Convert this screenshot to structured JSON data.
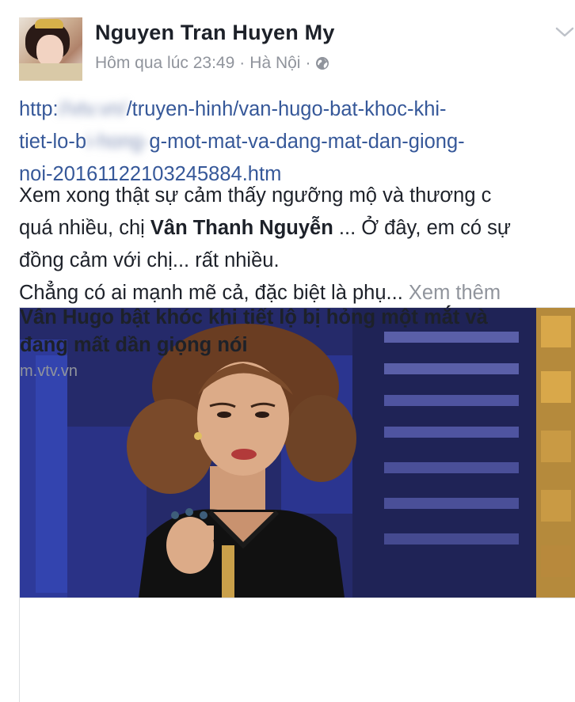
{
  "post": {
    "author": "Nguyen Tran Huyen My",
    "timestamp": "Hôm qua lúc 23:49",
    "separator": "·",
    "location": "Hà Nội",
    "privacy_icon": "globe-icon",
    "menu_icon": "chevron-down-icon",
    "link_lines": {
      "line1_start": "http:",
      "line1_blurred": "//vtv.vn/",
      "line1_end": "/truyen-hinh/van-hugo-bat-khoc-khi-",
      "line2_start": "tiet-lo-b",
      "line2_blurred": "i-hong-",
      "line2_end": "g-mot-mat-va-dang-mat-dan-giong-",
      "line3": "noi-20161122103245884.htm"
    },
    "body": {
      "line1": "Xem xong thật sự cảm thấy ngưỡng mộ và thương c",
      "line2_start": "quá nhiều, chị ",
      "line2_bold": "Vân Thanh Nguyễn",
      "line2_end": " ... Ở đây, em có sự",
      "line3": "đồng cảm với chị... rất nhiều.",
      "line4": "Chẳng có ai mạnh mẽ cả, đặc biệt là phụ...",
      "see_more": "Xem thêm"
    },
    "card": {
      "title_line1": "Vân Hugo bật khóc khi tiết lộ bị hỏng một mắt và",
      "title_line2": "đang mất dần giọng nói",
      "domain": "m.vtv.vn"
    }
  },
  "colors": {
    "link": "#365899",
    "text": "#1d2129",
    "meta": "#90949c",
    "card_border": "#dddfe2"
  }
}
